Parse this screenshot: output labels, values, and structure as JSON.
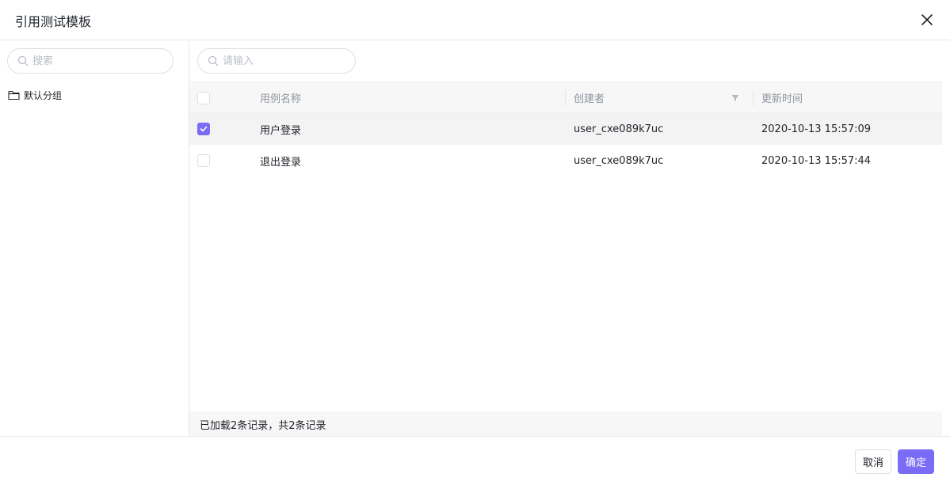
{
  "dialog": {
    "title": "引用测试模板"
  },
  "left_panel": {
    "search": {
      "placeholder": "搜索",
      "value": ""
    },
    "tree": [
      {
        "label": "默认分组",
        "icon": "folder-icon"
      }
    ]
  },
  "right_panel": {
    "search": {
      "placeholder": "请输入",
      "value": ""
    },
    "table": {
      "headers": {
        "name": "用例名称",
        "creator": "创建者",
        "updated": "更新时间"
      },
      "rows": [
        {
          "checked": true,
          "name": "用户登录",
          "creator": "user_cxe089k7uc",
          "updated": "2020-10-13 15:57:09"
        },
        {
          "checked": false,
          "name": "退出登录",
          "creator": "user_cxe089k7uc",
          "updated": "2020-10-13 15:57:44"
        }
      ]
    },
    "status": "已加载2条记录，共2条记录"
  },
  "footer": {
    "cancel_label": "取消",
    "ok_label": "确定"
  },
  "colors": {
    "accent": "#7b6cf6",
    "selected_row": "#f3f3f4",
    "header_bg": "#f7f7f8"
  }
}
